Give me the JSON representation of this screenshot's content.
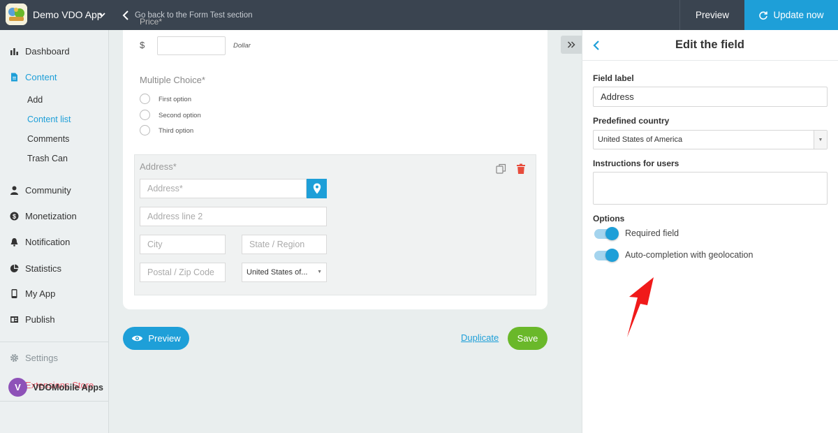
{
  "topbar": {
    "app_name": "Demo VDO App",
    "back_text": "Go back to the Form Test section",
    "preview_label": "Preview",
    "update_label": "Update now"
  },
  "sidebar": {
    "items": [
      {
        "label": "Dashboard",
        "icon": "bar-chart-icon"
      },
      {
        "label": "Content",
        "icon": "document-icon",
        "active": true
      },
      {
        "label": "Community",
        "icon": "person-icon"
      },
      {
        "label": "Monetization",
        "icon": "dollar-icon"
      },
      {
        "label": "Notification",
        "icon": "bell-icon"
      },
      {
        "label": "Statistics",
        "icon": "pie-chart-icon"
      },
      {
        "label": "My App",
        "icon": "phone-icon"
      },
      {
        "label": "Publish",
        "icon": "publish-icon"
      }
    ],
    "sub_items": [
      {
        "label": "Add"
      },
      {
        "label": "Content list",
        "active": true
      },
      {
        "label": "Comments"
      },
      {
        "label": "Trash Can"
      }
    ],
    "settings_label": "Settings",
    "extensions_label": "Extensions Store",
    "account_initial": "V",
    "account_name": "VDOMobile Apps"
  },
  "form": {
    "price_label": "Price*",
    "currency_symbol": "$",
    "currency_unit": "Dollar",
    "multiple_choice_title": "Multiple Choice*",
    "options": [
      "First option",
      "Second option",
      "Third option"
    ],
    "address_title": "Address*",
    "address_placeholder": "Address*",
    "address2_placeholder": "Address line 2",
    "city_placeholder": "City",
    "state_placeholder": "State / Region",
    "zip_placeholder": "Postal / Zip Code",
    "country_value": "United States of..."
  },
  "actions": {
    "preview_label": "Preview",
    "duplicate_label": "Duplicate",
    "save_label": "Save"
  },
  "panel": {
    "title": "Edit the field",
    "field_label_label": "Field label",
    "field_label_value": "Address",
    "predefined_country_label": "Predefined country",
    "predefined_country_value": "United States of America",
    "instructions_label": "Instructions for users",
    "instructions_value": "",
    "options_label": "Options",
    "toggles": [
      {
        "label": "Required field",
        "on": true
      },
      {
        "label": "Auto-completion with geolocation",
        "on": true
      }
    ]
  },
  "colors": {
    "accent": "#1e9fd8",
    "topbar": "#3a4450",
    "save": "#6ab82a",
    "delete": "#e74c3c",
    "annotation_arrow": "#f01a1a"
  }
}
